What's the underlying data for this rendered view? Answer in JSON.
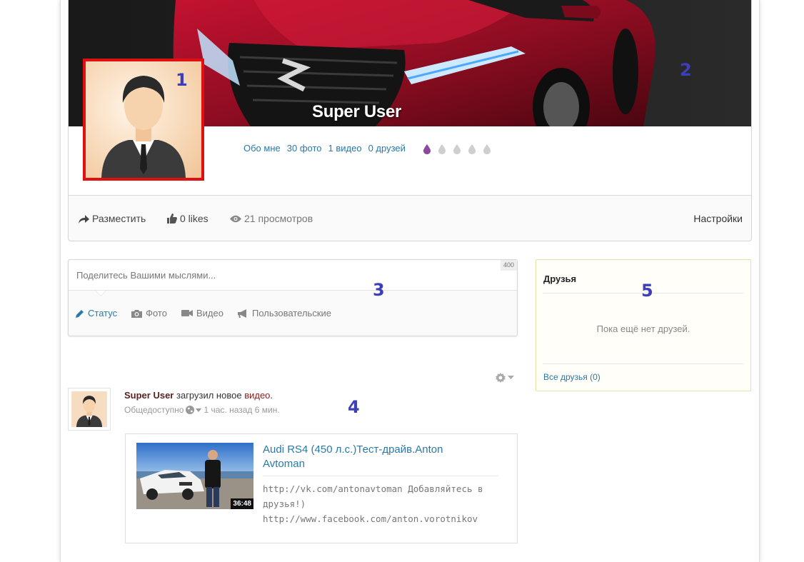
{
  "profile": {
    "name": "Super User",
    "links": [
      "Обо мне",
      "30 фото",
      "1 видео",
      "0 друзей"
    ],
    "drops": {
      "active": 1,
      "total": 5,
      "active_color": "#8b4a9c",
      "inactive_color": "#cfcfcf"
    },
    "frame_color": "#e01010"
  },
  "actions": {
    "share": "Разместить",
    "likes": "0 likes",
    "views": "21 просмотров",
    "settings": "Настройки"
  },
  "composer": {
    "placeholder": "Поделитесь Вашими мыслями...",
    "char_limit": "400",
    "tabs": [
      {
        "label": "Статус",
        "icon": "pencil-icon",
        "active": true
      },
      {
        "label": "Фото",
        "icon": "camera-icon",
        "active": false
      },
      {
        "label": "Видео",
        "icon": "video-camera-icon",
        "active": false
      },
      {
        "label": "Пользовательские",
        "icon": "megaphone-icon",
        "active": false
      }
    ]
  },
  "friends": {
    "title": "Друзья",
    "empty_text": "Пока ещё нет друзей.",
    "all_link": "Все друзья (0)"
  },
  "stream": {
    "author": "Super User",
    "action_text": "загрузил новое",
    "object_link": "видео",
    "period": ".",
    "privacy": "Общедоступно",
    "time": "1 час. назад 6 мин.",
    "attachment": {
      "title": "Audi RS4 (450 л.с.)Тест-драйв.Anton Avtoman",
      "duration": "36:48",
      "description_lines": [
        "http://vk.com/antonavtoman Добавляйтесь в",
        "друзья!)",
        "http://www.facebook.com/anton.vorotnikov"
      ]
    }
  },
  "annotations": [
    "1",
    "2",
    "3",
    "4",
    "5"
  ],
  "colors": {
    "link": "#2a79a8",
    "annotation": "#3c3fb8",
    "cover_car": "#9e0f24"
  }
}
